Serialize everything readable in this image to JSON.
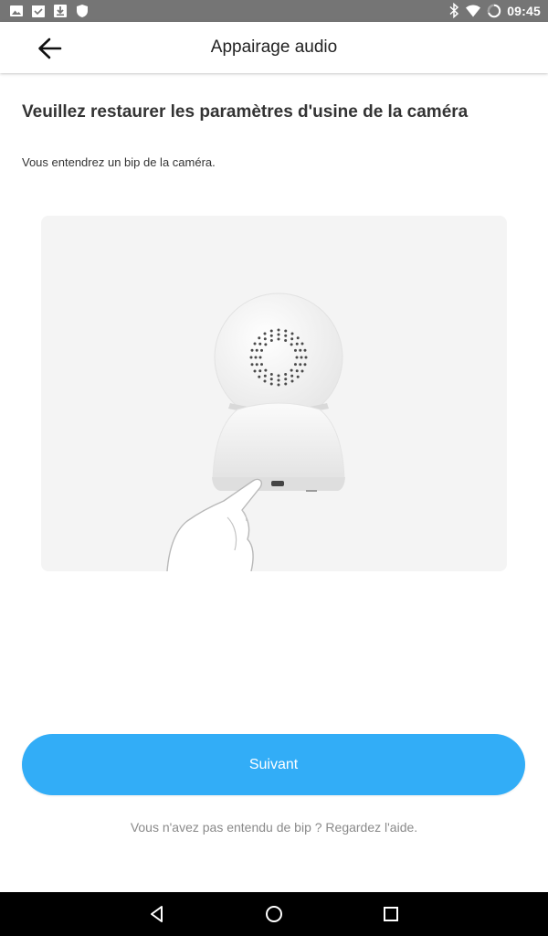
{
  "status_bar": {
    "time": "09:45",
    "left_icons": [
      "image-icon",
      "calendar-icon",
      "download-icon",
      "shield-icon"
    ],
    "right_icons": [
      "bluetooth-icon",
      "wifi-icon",
      "battery-icon"
    ]
  },
  "app_bar": {
    "title": "Appairage audio",
    "back_icon": "arrow-left-icon"
  },
  "content": {
    "heading": "Veuillez restaurer les paramètres d'usine de la caméra",
    "subtext": "Vous entendrez un bip de la caméra.",
    "illustration": "camera-reset-illustration"
  },
  "actions": {
    "next_label": "Suivant",
    "help_text": "Vous n'avez pas entendu de bip ? Regardez l'aide."
  },
  "nav_bar": {
    "icons": [
      "back-triangle-icon",
      "home-circle-icon",
      "recents-square-icon"
    ]
  },
  "colors": {
    "accent": "#32adf7",
    "status_bar": "#757575",
    "nav_bar": "#000000",
    "illustration_bg": "#f4f4f4"
  }
}
